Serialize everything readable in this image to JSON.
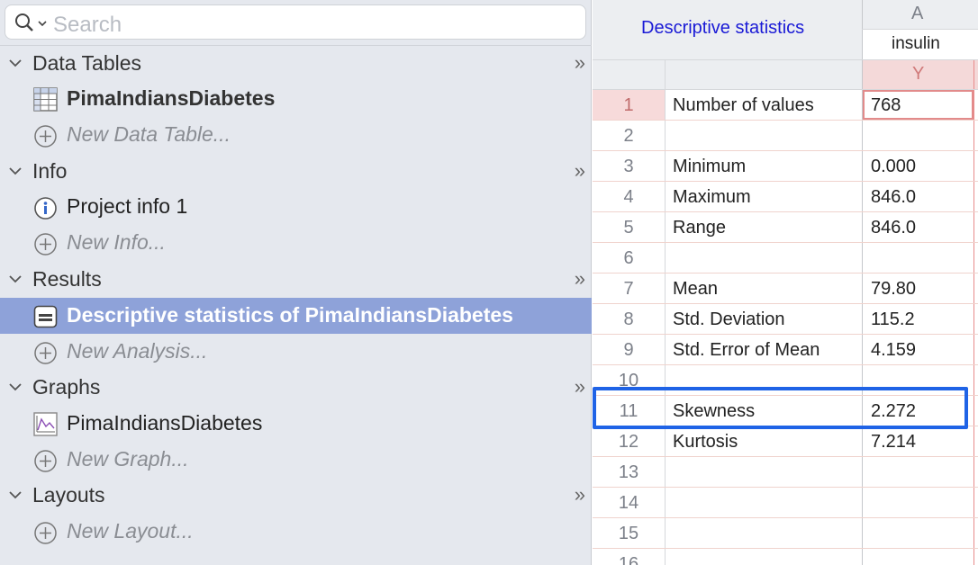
{
  "search": {
    "placeholder": "Search",
    "icon": "search-icon"
  },
  "sidebar": {
    "sections": [
      {
        "title": "Data Tables",
        "collapse": "»"
      },
      {
        "title": "Info",
        "collapse": "»"
      },
      {
        "title": "Results",
        "collapse": "»"
      },
      {
        "title": "Graphs",
        "collapse": "»"
      },
      {
        "title": "Layouts",
        "collapse": "»"
      }
    ],
    "items": {
      "data_table": "PimaIndiansDiabetes",
      "new_data_table": "New Data Table...",
      "project_info": "Project info 1",
      "new_info": "New Info...",
      "result": "Descriptive statistics of PimaIndiansDiabetes",
      "new_analysis": "New Analysis...",
      "graph": "PimaIndiansDiabetes",
      "new_graph": "New Graph...",
      "new_layout": "New Layout..."
    },
    "selected_color": "#8ea2d9"
  },
  "sheet": {
    "title": "Descriptive statistics",
    "column_letter": "A",
    "column_name": "insulin",
    "column_sub": "Y",
    "rows": [
      {
        "num": "1",
        "label": "Number of values",
        "value": "768"
      },
      {
        "num": "2",
        "label": "",
        "value": ""
      },
      {
        "num": "3",
        "label": "Minimum",
        "value": "0.000"
      },
      {
        "num": "4",
        "label": "Maximum",
        "value": "846.0"
      },
      {
        "num": "5",
        "label": "Range",
        "value": "846.0"
      },
      {
        "num": "6",
        "label": "",
        "value": ""
      },
      {
        "num": "7",
        "label": "Mean",
        "value": "79.80"
      },
      {
        "num": "8",
        "label": "Std. Deviation",
        "value": "115.2"
      },
      {
        "num": "9",
        "label": "Std. Error of Mean",
        "value": "4.159"
      },
      {
        "num": "10",
        "label": "",
        "value": ""
      },
      {
        "num": "11",
        "label": "Skewness",
        "value": "2.272"
      },
      {
        "num": "12",
        "label": "Kurtosis",
        "value": "7.214"
      },
      {
        "num": "13",
        "label": "",
        "value": ""
      },
      {
        "num": "14",
        "label": "",
        "value": ""
      },
      {
        "num": "15",
        "label": "",
        "value": ""
      },
      {
        "num": "16",
        "label": "",
        "value": ""
      }
    ],
    "title_color": "#1a1ad6",
    "highlight_color": "#1f63e6"
  }
}
